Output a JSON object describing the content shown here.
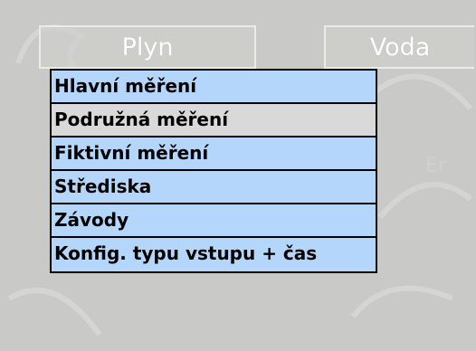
{
  "tabs": [
    {
      "label": "Plyn"
    },
    {
      "label": "Voda"
    }
  ],
  "menu": {
    "items": [
      {
        "label": "Hlavní měření",
        "selected": false
      },
      {
        "label": "Podružná měření",
        "selected": true
      },
      {
        "label": "Fiktivní měření",
        "selected": false
      },
      {
        "label": "Střediska",
        "selected": false
      },
      {
        "label": "Závody",
        "selected": false
      },
      {
        "label": "Konfig. typu vstupu + čas",
        "selected": false
      }
    ]
  },
  "colors": {
    "background": "#c9c9c7",
    "menu_item_bg": "#b4d6fb",
    "menu_selected_bg": "#d9d9d9",
    "tab_text": "#ffffff"
  }
}
